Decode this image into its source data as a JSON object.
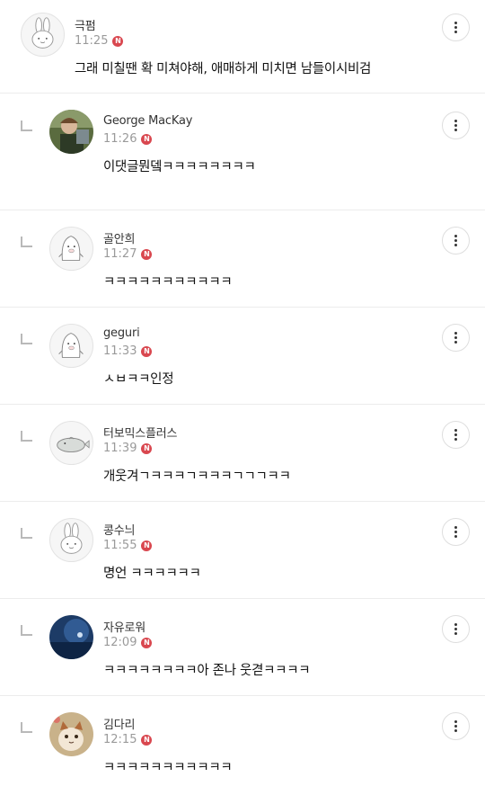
{
  "comments": [
    {
      "nickname": "극펌",
      "time": "11:25",
      "badge": "N",
      "text": "그래 미칠땐 확 미쳐야해, 애매하게 미치면 남들이시비검",
      "avatar": "rabbit-avatar-icon"
    },
    {
      "nickname": "George MacKay",
      "time": "11:26",
      "badge": "N",
      "text": "이댓글뭔뎈ㅋㅋㅋㅋㅋㅋㅋㅋ",
      "avatar": "photo-avatar"
    },
    {
      "nickname": "골안희",
      "time": "11:27",
      "badge": "N",
      "text": "ㅋㅋㅋㅋㅋㅋㅋㅋㅋㅋㅋ",
      "avatar": "penguin-avatar-icon"
    },
    {
      "nickname": "geguri",
      "time": "11:33",
      "badge": "N",
      "text": "ㅅㅂㅋㅋ인정",
      "avatar": "penguin-avatar-icon"
    },
    {
      "nickname": "터보믹스플러스",
      "time": "11:39",
      "badge": "N",
      "text": "개웃겨ㄱㅋㅋㅋㄱㅋㅋㅋㄱㄱㄱㅋㅋ",
      "avatar": "seal-avatar-icon"
    },
    {
      "nickname": "콩수늬",
      "time": "11:55",
      "badge": "N",
      "text": "명언 ㅋㅋㅋㅋㅋㅋ",
      "avatar": "rabbit-avatar-icon"
    },
    {
      "nickname": "자유로워",
      "time": "12:09",
      "badge": "N",
      "text": "ㅋㅋㅋㅋㅋㅋㅋㅋ아 존나 웃겯ㅋㅋㅋㅋ",
      "avatar": "photo-avatar"
    },
    {
      "nickname": "김다리",
      "time": "12:15",
      "badge": "N",
      "text": "ㅋㅋㅋㅋㅋㅋㅋㅋㅋㅋㅋ",
      "avatar": "cat-photo-avatar"
    }
  ]
}
